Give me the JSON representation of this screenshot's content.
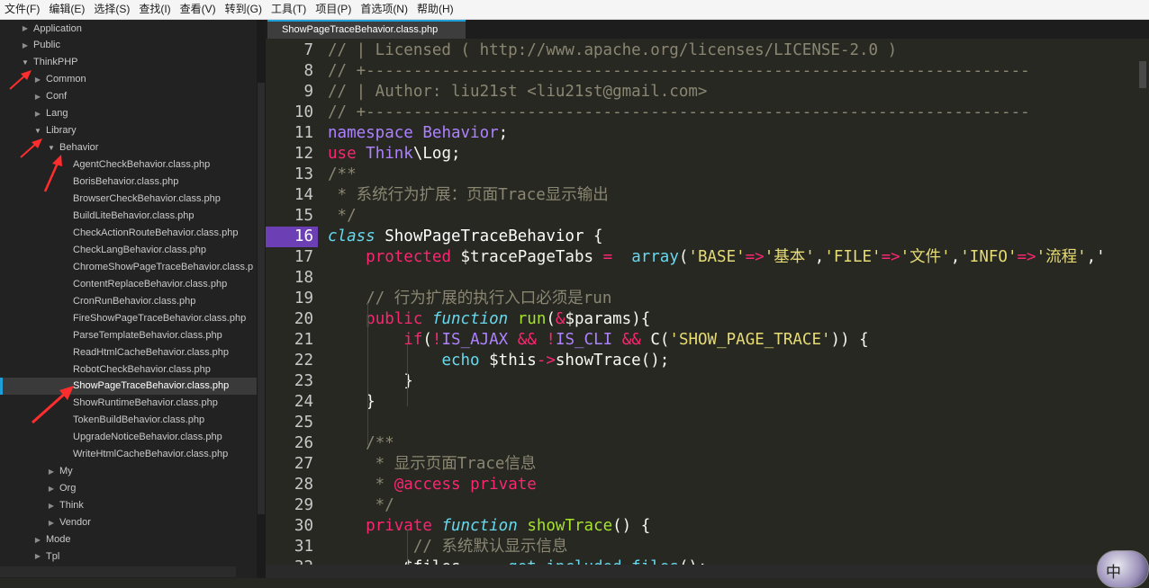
{
  "menubar": {
    "items": [
      "文件(F)",
      "编辑(E)",
      "选择(S)",
      "查找(I)",
      "查看(V)",
      "转到(G)",
      "工具(T)",
      "项目(P)",
      "首选项(N)",
      "帮助(H)"
    ]
  },
  "sidebar": {
    "tree": [
      {
        "label": "Application",
        "depth": 0,
        "state": "closed"
      },
      {
        "label": "Public",
        "depth": 0,
        "state": "closed"
      },
      {
        "label": "ThinkPHP",
        "depth": 0,
        "state": "open"
      },
      {
        "label": "Common",
        "depth": 1,
        "state": "closed"
      },
      {
        "label": "Conf",
        "depth": 1,
        "state": "closed"
      },
      {
        "label": "Lang",
        "depth": 1,
        "state": "closed"
      },
      {
        "label": "Library",
        "depth": 1,
        "state": "open"
      },
      {
        "label": "Behavior",
        "depth": 2,
        "state": "open"
      },
      {
        "label": "AgentCheckBehavior.class.php",
        "depth": 3,
        "state": "file"
      },
      {
        "label": "BorisBehavior.class.php",
        "depth": 3,
        "state": "file"
      },
      {
        "label": "BrowserCheckBehavior.class.php",
        "depth": 3,
        "state": "file"
      },
      {
        "label": "BuildLiteBehavior.class.php",
        "depth": 3,
        "state": "file"
      },
      {
        "label": "CheckActionRouteBehavior.class.php",
        "depth": 3,
        "state": "file"
      },
      {
        "label": "CheckLangBehavior.class.php",
        "depth": 3,
        "state": "file"
      },
      {
        "label": "ChromeShowPageTraceBehavior.class.p",
        "depth": 3,
        "state": "file"
      },
      {
        "label": "ContentReplaceBehavior.class.php",
        "depth": 3,
        "state": "file"
      },
      {
        "label": "CronRunBehavior.class.php",
        "depth": 3,
        "state": "file"
      },
      {
        "label": "FireShowPageTraceBehavior.class.php",
        "depth": 3,
        "state": "file"
      },
      {
        "label": "ParseTemplateBehavior.class.php",
        "depth": 3,
        "state": "file"
      },
      {
        "label": "ReadHtmlCacheBehavior.class.php",
        "depth": 3,
        "state": "file"
      },
      {
        "label": "RobotCheckBehavior.class.php",
        "depth": 3,
        "state": "file"
      },
      {
        "label": "ShowPageTraceBehavior.class.php",
        "depth": 3,
        "state": "file",
        "selected": true
      },
      {
        "label": "ShowRuntimeBehavior.class.php",
        "depth": 3,
        "state": "file"
      },
      {
        "label": "TokenBuildBehavior.class.php",
        "depth": 3,
        "state": "file"
      },
      {
        "label": "UpgradeNoticeBehavior.class.php",
        "depth": 3,
        "state": "file"
      },
      {
        "label": "WriteHtmlCacheBehavior.class.php",
        "depth": 3,
        "state": "file"
      },
      {
        "label": "My",
        "depth": 2,
        "state": "closed"
      },
      {
        "label": "Org",
        "depth": 2,
        "state": "closed"
      },
      {
        "label": "Think",
        "depth": 2,
        "state": "closed"
      },
      {
        "label": "Vendor",
        "depth": 2,
        "state": "closed"
      },
      {
        "label": "Mode",
        "depth": 1,
        "state": "closed"
      },
      {
        "label": "Tpl",
        "depth": 1,
        "state": "closed"
      }
    ]
  },
  "tab": {
    "label": "ShowPageTraceBehavior.class.php"
  },
  "editor": {
    "current_line": 16,
    "lines": [
      {
        "n": 7,
        "t": [
          [
            "c",
            "// | Licensed ( http://www.apache.org/licenses/LICENSE-2.0 )"
          ]
        ]
      },
      {
        "n": 8,
        "t": [
          [
            "c",
            "// +----------------------------------------------------------------------"
          ]
        ]
      },
      {
        "n": 9,
        "t": [
          [
            "c",
            "// | Author: liu21st <liu21st@gmail.com>"
          ]
        ]
      },
      {
        "n": 10,
        "t": [
          [
            "c",
            "// +----------------------------------------------------------------------"
          ]
        ]
      },
      {
        "n": 11,
        "t": [
          [
            "nm",
            "namespace"
          ],
          [
            "pl",
            " "
          ],
          [
            "nm",
            "Behavior"
          ],
          [
            "pl",
            ";"
          ]
        ]
      },
      {
        "n": 12,
        "t": [
          [
            "kw",
            "use"
          ],
          [
            "pl",
            " "
          ],
          [
            "nm",
            "Think"
          ],
          [
            "pl",
            "\\"
          ],
          [
            "pl",
            "Log;"
          ]
        ]
      },
      {
        "n": 13,
        "t": [
          [
            "c",
            "/**"
          ]
        ]
      },
      {
        "n": 14,
        "t": [
          [
            "c",
            " * 系统行为扩展：页面Trace显示输出"
          ]
        ]
      },
      {
        "n": 15,
        "t": [
          [
            "c",
            " */"
          ]
        ]
      },
      {
        "n": 16,
        "t": [
          [
            "ty",
            "class"
          ],
          [
            "cls",
            " ShowPageTraceBehavior"
          ],
          [
            "pl",
            " {"
          ]
        ]
      },
      {
        "n": 17,
        "t": [
          [
            "pl",
            "    "
          ],
          [
            "kw",
            "protected"
          ],
          [
            "pl",
            " $tracePageTabs "
          ],
          [
            "kw",
            "="
          ],
          [
            "pl",
            "  "
          ],
          [
            "bu",
            "array"
          ],
          [
            "pl",
            "("
          ],
          [
            "st",
            "'BASE'"
          ],
          [
            "kw",
            "=>"
          ],
          [
            "st",
            "'基本'"
          ],
          [
            "pl",
            ","
          ],
          [
            "st",
            "'FILE'"
          ],
          [
            "kw",
            "=>"
          ],
          [
            "st",
            "'文件'"
          ],
          [
            "pl",
            ","
          ],
          [
            "st",
            "'INFO'"
          ],
          [
            "kw",
            "=>"
          ],
          [
            "st",
            "'流程'"
          ],
          [
            "pl",
            ",'"
          ]
        ]
      },
      {
        "n": 18,
        "t": [
          [
            "pl",
            ""
          ]
        ]
      },
      {
        "n": 19,
        "t": [
          [
            "pl",
            "    "
          ],
          [
            "c",
            "// 行为扩展的执行入口必须是run"
          ]
        ]
      },
      {
        "n": 20,
        "t": [
          [
            "pl",
            "    "
          ],
          [
            "kw",
            "public"
          ],
          [
            "pl",
            " "
          ],
          [
            "ty",
            "function"
          ],
          [
            "pl",
            " "
          ],
          [
            "fn",
            "run"
          ],
          [
            "pl",
            "("
          ],
          [
            "kw",
            "&"
          ],
          [
            "pl",
            "$params){"
          ]
        ]
      },
      {
        "n": 21,
        "t": [
          [
            "pl",
            "        "
          ],
          [
            "kw",
            "if"
          ],
          [
            "pl",
            "("
          ],
          [
            "kw",
            "!"
          ],
          [
            "nm",
            "IS_AJAX"
          ],
          [
            "pl",
            " "
          ],
          [
            "kw",
            "&&"
          ],
          [
            "pl",
            " "
          ],
          [
            "kw",
            "!"
          ],
          [
            "nm",
            "IS_CLI"
          ],
          [
            "pl",
            " "
          ],
          [
            "kw",
            "&&"
          ],
          [
            "pl",
            " C("
          ],
          [
            "st",
            "'SHOW_PAGE_TRACE'"
          ],
          [
            "pl",
            ")) {"
          ]
        ]
      },
      {
        "n": 22,
        "t": [
          [
            "pl",
            "            "
          ],
          [
            "bu",
            "echo"
          ],
          [
            "pl",
            " $this"
          ],
          [
            "kw",
            "->"
          ],
          [
            "pl",
            "showTrace();"
          ]
        ]
      },
      {
        "n": 23,
        "t": [
          [
            "pl",
            "        }"
          ]
        ]
      },
      {
        "n": 24,
        "t": [
          [
            "pl",
            "    }"
          ]
        ]
      },
      {
        "n": 25,
        "t": [
          [
            "pl",
            ""
          ]
        ]
      },
      {
        "n": 26,
        "t": [
          [
            "pl",
            "    "
          ],
          [
            "c",
            "/**"
          ]
        ]
      },
      {
        "n": 27,
        "t": [
          [
            "c",
            "     * 显示页面Trace信息"
          ]
        ]
      },
      {
        "n": 28,
        "t": [
          [
            "c",
            "     * "
          ],
          [
            "kw",
            "@access"
          ],
          [
            "kw",
            " private"
          ]
        ]
      },
      {
        "n": 29,
        "t": [
          [
            "c",
            "     */"
          ]
        ]
      },
      {
        "n": 30,
        "t": [
          [
            "pl",
            "    "
          ],
          [
            "kw",
            "private"
          ],
          [
            "pl",
            " "
          ],
          [
            "ty",
            "function"
          ],
          [
            "pl",
            " "
          ],
          [
            "fn",
            "showTrace"
          ],
          [
            "pl",
            "() {"
          ]
        ]
      },
      {
        "n": 31,
        "t": [
          [
            "pl",
            "         "
          ],
          [
            "c",
            "// 系统默认显示信息"
          ]
        ]
      },
      {
        "n": 32,
        "t": [
          [
            "pl",
            "        $files  "
          ],
          [
            "kw",
            "="
          ],
          [
            "pl",
            "  "
          ],
          [
            "bu",
            "get_included_files"
          ],
          [
            "pl",
            "();"
          ]
        ]
      }
    ]
  },
  "overlay": {
    "avatar_text": "中"
  }
}
